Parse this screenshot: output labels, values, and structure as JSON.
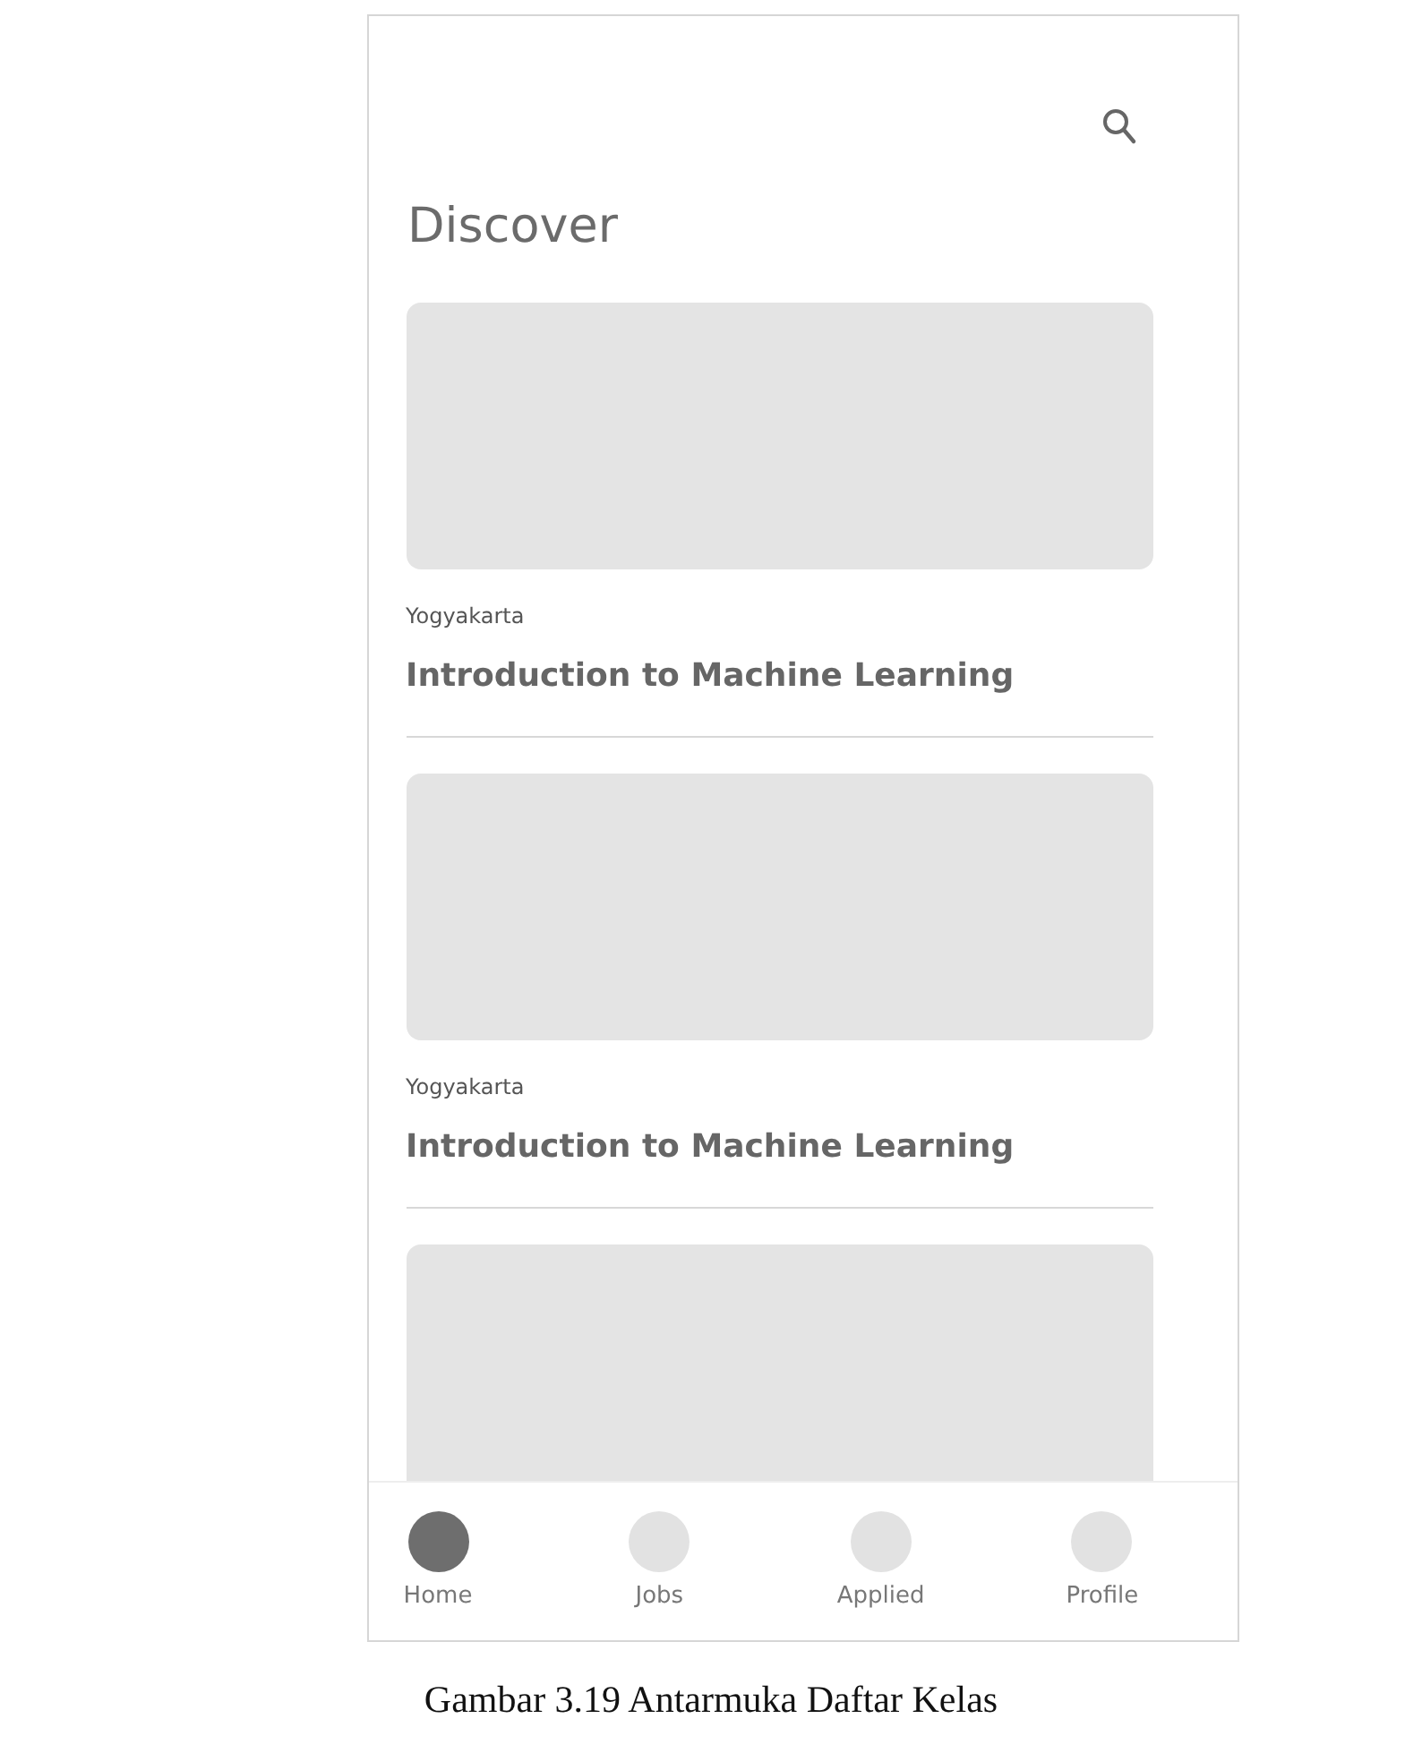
{
  "screen": {
    "title": "Discover"
  },
  "cards": [
    {
      "kind": "course",
      "location": "Yogyakarta",
      "title": "Introduction to Machine Learning"
    },
    {
      "kind": "course",
      "location": "Yogyakarta",
      "title": "Introduction to Machine Learning"
    },
    {
      "kind": "image-only"
    }
  ],
  "bottom_nav": [
    {
      "label": "Home",
      "selected": true
    },
    {
      "label": "Jobs",
      "selected": false
    },
    {
      "label": "Applied",
      "selected": false
    },
    {
      "label": "Profile",
      "selected": false
    }
  ],
  "caption": "Gambar 3.19 Antarmuka Daftar Kelas"
}
